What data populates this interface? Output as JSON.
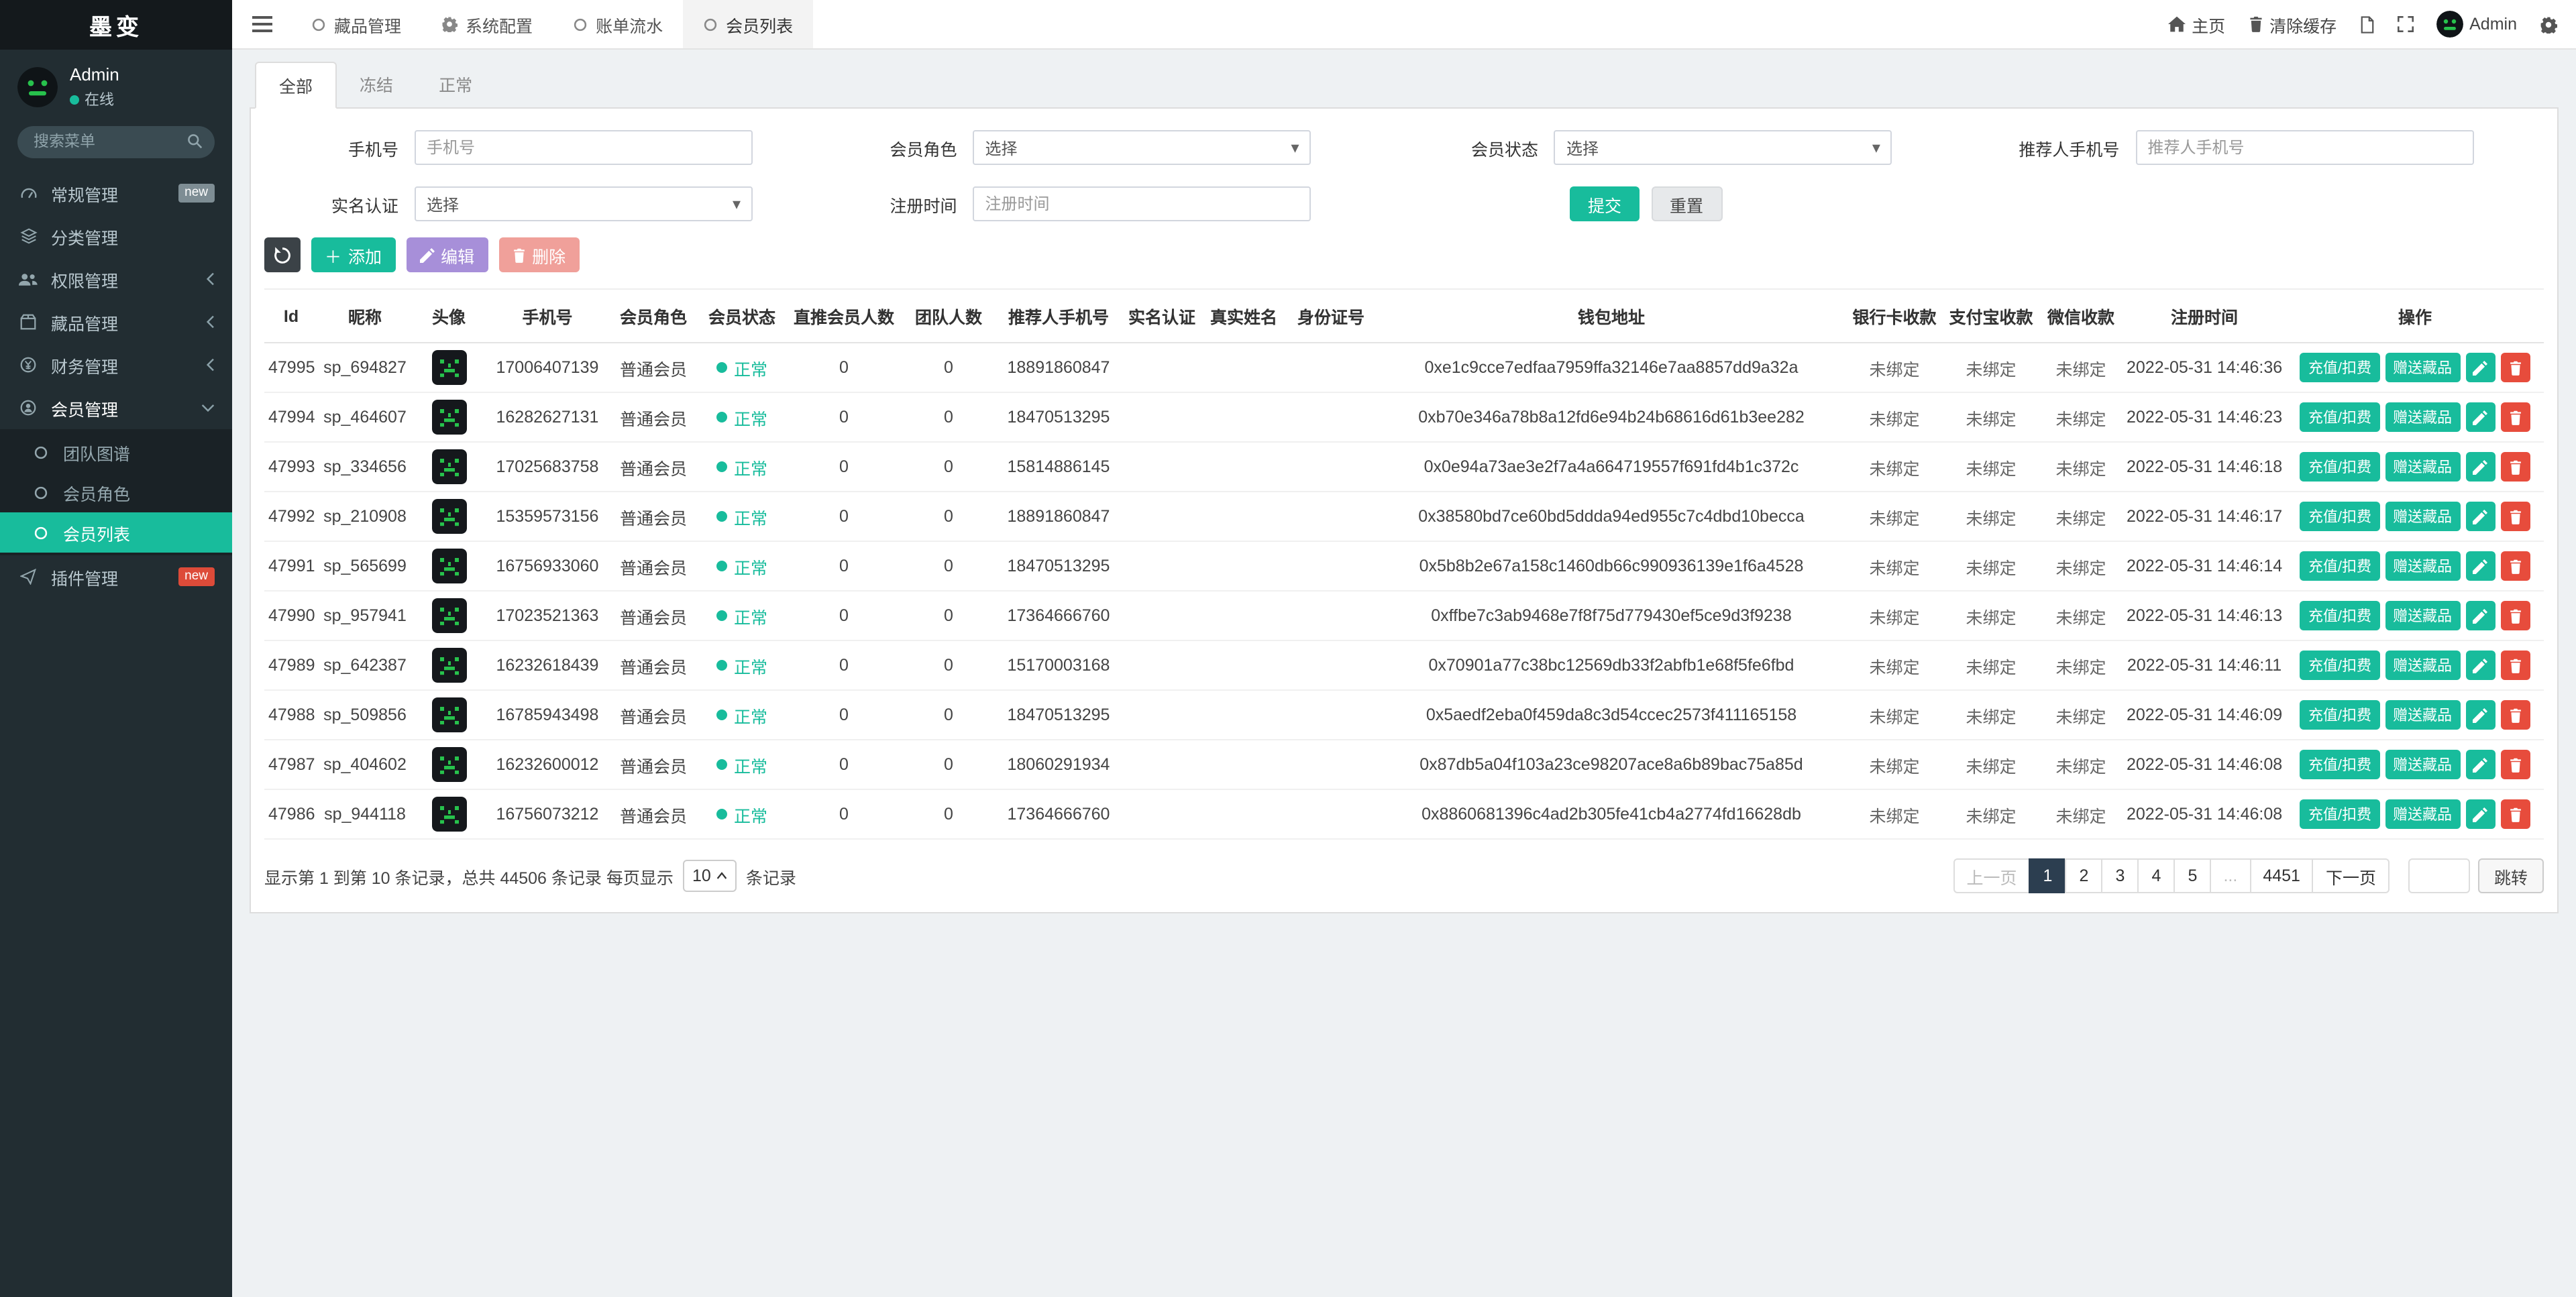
{
  "brand": "墨变",
  "user": {
    "name": "Admin",
    "status_label": "在线"
  },
  "sidebar": {
    "search_placeholder": "搜索菜单",
    "items": [
      {
        "key": "general",
        "label": "常规管理",
        "icon": "gauge-icon",
        "badge": "new",
        "badge_color": "gray"
      },
      {
        "key": "category",
        "label": "分类管理",
        "icon": "layers-icon"
      },
      {
        "key": "permission",
        "label": "权限管理",
        "icon": "users-icon",
        "collapsible": true
      },
      {
        "key": "collection",
        "label": "藏品管理",
        "icon": "box-icon",
        "collapsible": true
      },
      {
        "key": "finance",
        "label": "财务管理",
        "icon": "finance-icon",
        "collapsible": true
      },
      {
        "key": "member",
        "label": "会员管理",
        "icon": "member-icon",
        "collapsible": true,
        "expanded": true,
        "children": [
          {
            "label": "团队图谱"
          },
          {
            "label": "会员角色"
          },
          {
            "label": "会员列表",
            "active": true
          }
        ]
      },
      {
        "key": "plugin",
        "label": "插件管理",
        "icon": "plane-icon",
        "badge": "new",
        "badge_color": "red"
      }
    ]
  },
  "topbar": {
    "tabs": [
      {
        "label": "藏品管理",
        "icon": "circle-icon"
      },
      {
        "label": "系统配置",
        "icon": "gear-icon"
      },
      {
        "label": "账单流水",
        "icon": "circle-icon"
      },
      {
        "label": "会员列表",
        "icon": "circle-icon",
        "active": true
      }
    ],
    "right": {
      "home_label": "主页",
      "clear_cache_label": "清除缓存",
      "username": "Admin"
    }
  },
  "content_tabs": [
    {
      "label": "全部",
      "active": true
    },
    {
      "label": "冻结"
    },
    {
      "label": "正常"
    }
  ],
  "filters": {
    "phone_label": "手机号",
    "phone_placeholder": "手机号",
    "role_label": "会员角色",
    "role_value": "选择",
    "status_label": "会员状态",
    "status_value": "选择",
    "referrer_label": "推荐人手机号",
    "referrer_placeholder": "推荐人手机号",
    "realname_label": "实名认证",
    "realname_value": "选择",
    "regtime_label": "注册时间",
    "regtime_placeholder": "注册时间",
    "submit_label": "提交",
    "reset_label": "重置"
  },
  "toolbar": {
    "add_label": "添加",
    "edit_label": "编辑",
    "delete_label": "删除"
  },
  "table": {
    "headers": [
      "Id",
      "昵称",
      "头像",
      "手机号",
      "会员角色",
      "会员状态",
      "直推会员人数",
      "团队人数",
      "推荐人手机号",
      "实名认证",
      "真实姓名",
      "身份证号",
      "钱包地址",
      "银行卡收款",
      "支付宝收款",
      "微信收款",
      "注册时间",
      "操作"
    ],
    "row_actions": {
      "recharge": "充值/扣费",
      "gift": "赠送藏品"
    },
    "rows": [
      {
        "id": "47995",
        "nickname": "sp_694827",
        "phone": "17006407139",
        "role": "普通会员",
        "status": "正常",
        "direct_count": "0",
        "team_count": "0",
        "referrer_phone": "18891860847",
        "realname_auth": "",
        "real_name": "",
        "id_card": "",
        "wallet": "0xe1c9cce7edfaa7959ffa32146e7aa8857dd9a32a",
        "bank": "未绑定",
        "alipay": "未绑定",
        "wechat": "未绑定",
        "reg_time": "2022-05-31 14:46:36"
      },
      {
        "id": "47994",
        "nickname": "sp_464607",
        "phone": "16282627131",
        "role": "普通会员",
        "status": "正常",
        "direct_count": "0",
        "team_count": "0",
        "referrer_phone": "18470513295",
        "realname_auth": "",
        "real_name": "",
        "id_card": "",
        "wallet": "0xb70e346a78b8a12fd6e94b24b68616d61b3ee282",
        "bank": "未绑定",
        "alipay": "未绑定",
        "wechat": "未绑定",
        "reg_time": "2022-05-31 14:46:23"
      },
      {
        "id": "47993",
        "nickname": "sp_334656",
        "phone": "17025683758",
        "role": "普通会员",
        "status": "正常",
        "direct_count": "0",
        "team_count": "0",
        "referrer_phone": "15814886145",
        "realname_auth": "",
        "real_name": "",
        "id_card": "",
        "wallet": "0x0e94a73ae3e2f7a4a664719557f691fd4b1c372c",
        "bank": "未绑定",
        "alipay": "未绑定",
        "wechat": "未绑定",
        "reg_time": "2022-05-31 14:46:18"
      },
      {
        "id": "47992",
        "nickname": "sp_210908",
        "phone": "15359573156",
        "role": "普通会员",
        "status": "正常",
        "direct_count": "0",
        "team_count": "0",
        "referrer_phone": "18891860847",
        "realname_auth": "",
        "real_name": "",
        "id_card": "",
        "wallet": "0x38580bd7ce60bd5ddda94ed955c7c4dbd10becca",
        "bank": "未绑定",
        "alipay": "未绑定",
        "wechat": "未绑定",
        "reg_time": "2022-05-31 14:46:17"
      },
      {
        "id": "47991",
        "nickname": "sp_565699",
        "phone": "16756933060",
        "role": "普通会员",
        "status": "正常",
        "direct_count": "0",
        "team_count": "0",
        "referrer_phone": "18470513295",
        "realname_auth": "",
        "real_name": "",
        "id_card": "",
        "wallet": "0x5b8b2e67a158c1460db66c990936139e1f6a4528",
        "bank": "未绑定",
        "alipay": "未绑定",
        "wechat": "未绑定",
        "reg_time": "2022-05-31 14:46:14"
      },
      {
        "id": "47990",
        "nickname": "sp_957941",
        "phone": "17023521363",
        "role": "普通会员",
        "status": "正常",
        "direct_count": "0",
        "team_count": "0",
        "referrer_phone": "17364666760",
        "realname_auth": "",
        "real_name": "",
        "id_card": "",
        "wallet": "0xffbe7c3ab9468e7f8f75d779430ef5ce9d3f9238",
        "bank": "未绑定",
        "alipay": "未绑定",
        "wechat": "未绑定",
        "reg_time": "2022-05-31 14:46:13"
      },
      {
        "id": "47989",
        "nickname": "sp_642387",
        "phone": "16232618439",
        "role": "普通会员",
        "status": "正常",
        "direct_count": "0",
        "team_count": "0",
        "referrer_phone": "15170003168",
        "realname_auth": "",
        "real_name": "",
        "id_card": "",
        "wallet": "0x70901a77c38bc12569db33f2abfb1e68f5fe6fbd",
        "bank": "未绑定",
        "alipay": "未绑定",
        "wechat": "未绑定",
        "reg_time": "2022-05-31 14:46:11"
      },
      {
        "id": "47988",
        "nickname": "sp_509856",
        "phone": "16785943498",
        "role": "普通会员",
        "status": "正常",
        "direct_count": "0",
        "team_count": "0",
        "referrer_phone": "18470513295",
        "realname_auth": "",
        "real_name": "",
        "id_card": "",
        "wallet": "0x5aedf2eba0f459da8c3d54ccec2573f411165158",
        "bank": "未绑定",
        "alipay": "未绑定",
        "wechat": "未绑定",
        "reg_time": "2022-05-31 14:46:09"
      },
      {
        "id": "47987",
        "nickname": "sp_404602",
        "phone": "16232600012",
        "role": "普通会员",
        "status": "正常",
        "direct_count": "0",
        "team_count": "0",
        "referrer_phone": "18060291934",
        "realname_auth": "",
        "real_name": "",
        "id_card": "",
        "wallet": "0x87db5a04f103a23ce98207ace8a6b89bac75a85d",
        "bank": "未绑定",
        "alipay": "未绑定",
        "wechat": "未绑定",
        "reg_time": "2022-05-31 14:46:08"
      },
      {
        "id": "47986",
        "nickname": "sp_944118",
        "phone": "16756073212",
        "role": "普通会员",
        "status": "正常",
        "direct_count": "0",
        "team_count": "0",
        "referrer_phone": "17364666760",
        "realname_auth": "",
        "real_name": "",
        "id_card": "",
        "wallet": "0x8860681396c4ad2b305fe41cb4a2774fd16628db",
        "bank": "未绑定",
        "alipay": "未绑定",
        "wechat": "未绑定",
        "reg_time": "2022-05-31 14:46:08"
      }
    ]
  },
  "footer": {
    "summary_prefix": "显示第 1 到第 10 条记录，总共 44506 条记录 每页显示",
    "page_size": "10",
    "summary_suffix": "条记录",
    "pages": [
      "上一页",
      "1",
      "2",
      "3",
      "4",
      "5",
      "...",
      "4451",
      "下一页"
    ],
    "active_page": "1",
    "disabled_pages": [
      "上一页",
      "..."
    ],
    "jump_label": "跳转"
  },
  "colors": {
    "accent": "#18bc9c",
    "danger": "#e74c3c",
    "dark": "#2c3e50",
    "sidebar": "#222d32"
  }
}
